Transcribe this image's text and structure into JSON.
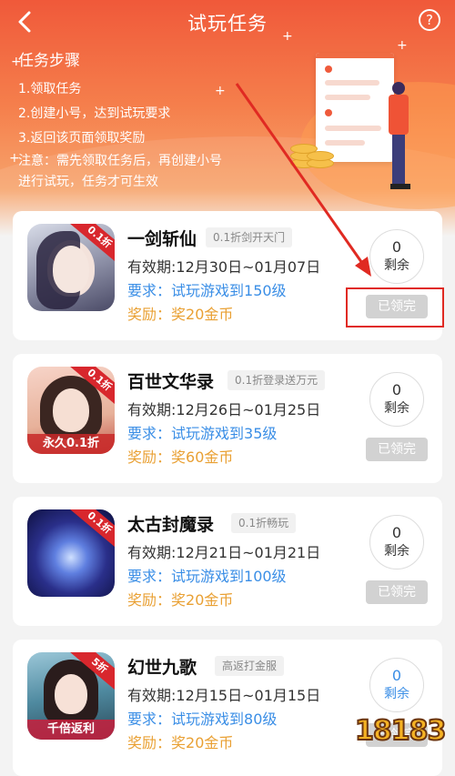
{
  "header": {
    "back_icon": "chevron-left-icon",
    "title": "试玩任务",
    "help_icon": "question-circle-icon",
    "help_glyph": "?"
  },
  "steps": {
    "title": "任务步骤",
    "items": [
      "1.领取任务",
      "2.创建小号，达到试玩要求",
      "3.返回该页面领取奖励"
    ],
    "note_line1": "注意：需先领取任务后，再创建小号",
    "note_line2": "进行试玩，任务才可生效"
  },
  "colors": {
    "header_top": "#f0593a",
    "header_bottom": "#f7a46c",
    "requirement": "#3a8ee6",
    "reward": "#e9a033",
    "claimed_button": "#d2d2d2",
    "annotation_red": "#e02a22"
  },
  "tasks": [
    {
      "name": "一剑斩仙",
      "tag": "0.1折剑开天门",
      "validity": "有效期:12月30日~01月07日",
      "req_label": "要求：",
      "req_value": "试玩游戏到150级",
      "reward_label": "奖励：",
      "reward_value": "奖20金币",
      "remain_num": "0",
      "remain_label": "剩余",
      "button": "已领完",
      "badge": "0.1折",
      "icon": "game-icon-yijian"
    },
    {
      "name": "百世文华录",
      "tag": "0.1折登录送万元",
      "validity": "有效期:12月26日~01月25日",
      "req_label": "要求：",
      "req_value": "试玩游戏到35级",
      "reward_label": "奖励：",
      "reward_value": "奖60金币",
      "remain_num": "0",
      "remain_label": "剩余",
      "button": "已领完",
      "badge": "0.1折",
      "icon_caption": "永久0.1折",
      "icon": "game-icon-baishi"
    },
    {
      "name": "太古封魔录",
      "tag": "0.1折畅玩",
      "validity": "有效期:12月21日~01月21日",
      "req_label": "要求：",
      "req_value": "试玩游戏到100级",
      "reward_label": "奖励：",
      "reward_value": "奖20金币",
      "remain_num": "0",
      "remain_label": "剩余",
      "button": "已领完",
      "badge": "0.1折",
      "icon": "game-icon-taigu"
    },
    {
      "name": "幻世九歌",
      "tag": "高返打金服",
      "validity": "有效期:12月15日~01月15日",
      "req_label": "要求：",
      "req_value": "试玩游戏到80级",
      "reward_label": "奖励：",
      "reward_value": "奖20金币",
      "remain_num": "0",
      "remain_label": "剩余",
      "button": "已领完",
      "badge": "5折",
      "icon_caption": "千倍返利",
      "icon": "game-icon-huanshi"
    }
  ],
  "watermark": "18183"
}
